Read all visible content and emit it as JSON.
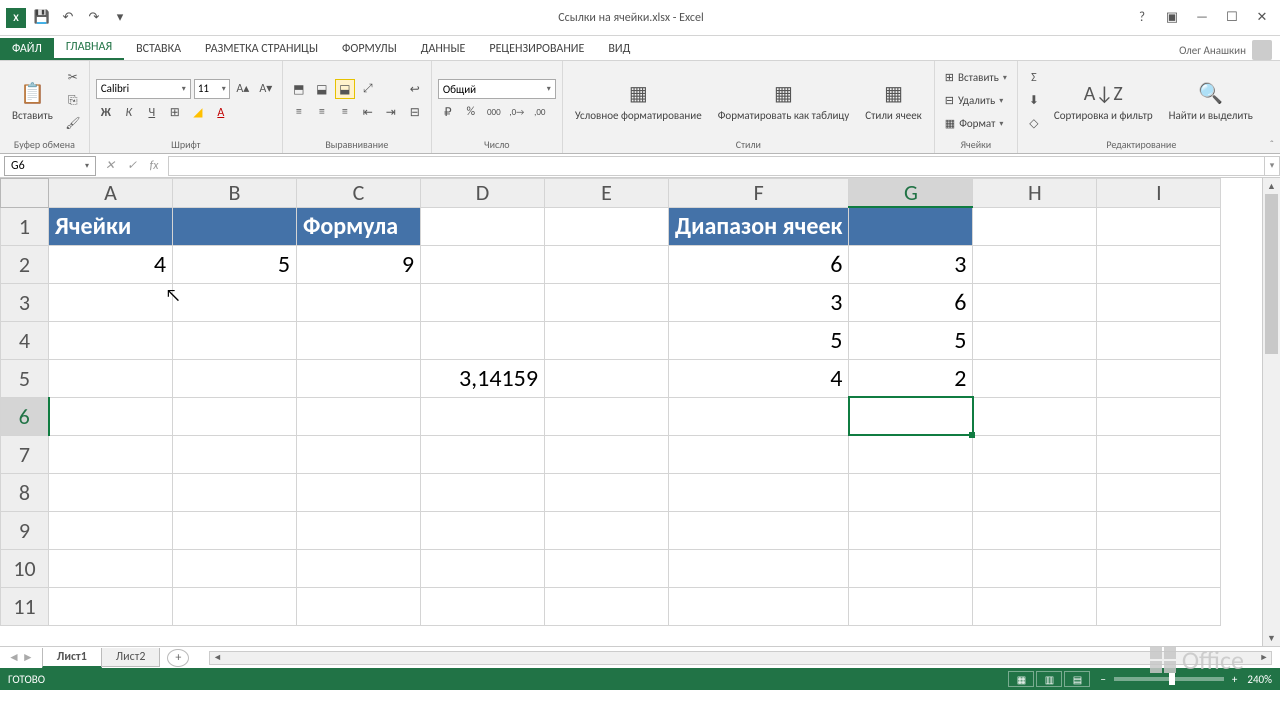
{
  "title": "Ссылки на ячейки.xlsx - Excel",
  "user": "Олег Анашкин",
  "tabs": {
    "file": "ФАЙЛ",
    "list": [
      "ГЛАВНАЯ",
      "ВСТАВКА",
      "РАЗМЕТКА СТРАНИЦЫ",
      "ФОРМУЛЫ",
      "ДАННЫЕ",
      "РЕЦЕНЗИРОВАНИЕ",
      "ВИД"
    ],
    "active": 0
  },
  "ribbon": {
    "clipboard": {
      "paste": "Вставить",
      "label": "Буфер обмена"
    },
    "font": {
      "name": "Calibri",
      "size": "11",
      "label": "Шрифт",
      "bold": "Ж",
      "italic": "К",
      "underline": "Ч"
    },
    "align": {
      "label": "Выравнивание"
    },
    "number": {
      "format": "Общий",
      "label": "Число"
    },
    "styles": {
      "cond": "Условное форматирование",
      "table": "Форматировать как таблицу",
      "cell": "Стили ячеек",
      "label": "Стили"
    },
    "cells": {
      "insert": "Вставить",
      "delete": "Удалить",
      "format": "Формат",
      "label": "Ячейки"
    },
    "editing": {
      "sort": "Сортировка и фильтр",
      "find": "Найти и выделить",
      "label": "Редактирование"
    }
  },
  "namebox": "G6",
  "formula": "",
  "columns": [
    "A",
    "B",
    "C",
    "D",
    "E",
    "F",
    "G",
    "H",
    "I"
  ],
  "selected_col": "G",
  "selected_row": 6,
  "rows": [
    1,
    2,
    3,
    4,
    5,
    6,
    7,
    8,
    9,
    10,
    11
  ],
  "cells": {
    "A1": {
      "v": "Ячейки",
      "h": true,
      "t": true
    },
    "B1": {
      "v": "",
      "h": true
    },
    "C1": {
      "v": "Формула",
      "h": true,
      "t": true
    },
    "F1": {
      "v": "Диапазон ячеек",
      "h": true,
      "t": true,
      "span": 2
    },
    "G1": {
      "v": "",
      "h": true
    },
    "A2": {
      "v": "4"
    },
    "B2": {
      "v": "5"
    },
    "C2": {
      "v": "9"
    },
    "F2": {
      "v": "6"
    },
    "G2": {
      "v": "3"
    },
    "F3": {
      "v": "3"
    },
    "G3": {
      "v": "6"
    },
    "F4": {
      "v": "5"
    },
    "G4": {
      "v": "5"
    },
    "D5": {
      "v": "3,14159"
    },
    "F5": {
      "v": "4"
    },
    "G5": {
      "v": "2"
    }
  },
  "sheets": {
    "list": [
      "Лист1",
      "Лист2"
    ],
    "active": 0
  },
  "status": {
    "ready": "ГОТОВО",
    "zoom": "240%"
  },
  "office": "Office"
}
